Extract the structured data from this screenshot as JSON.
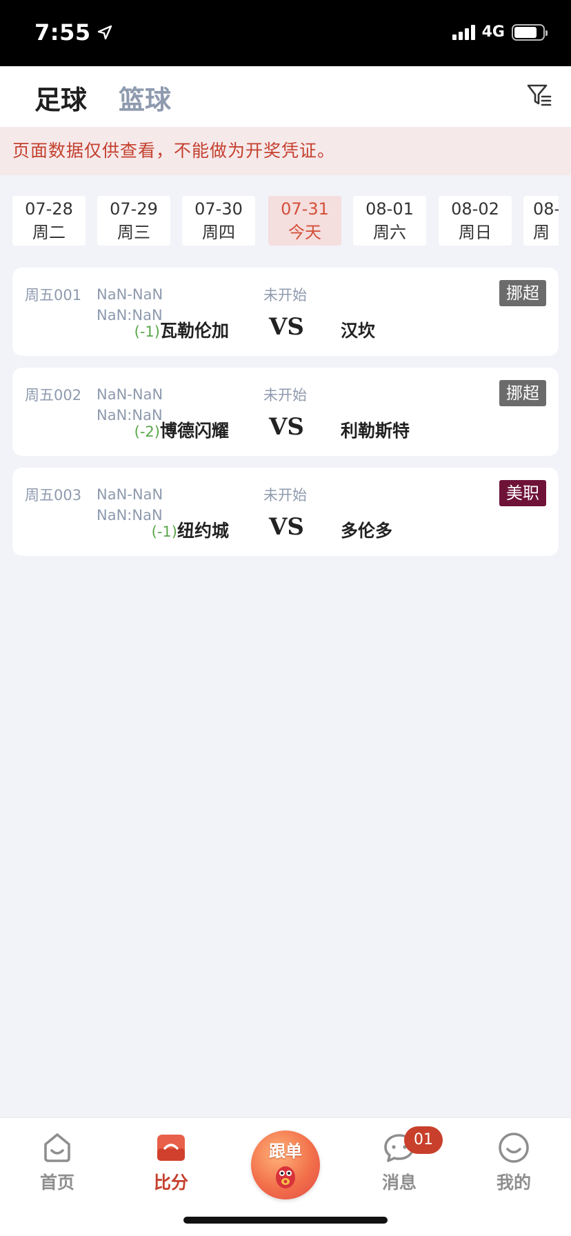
{
  "status_bar": {
    "time": "7:55",
    "network": "4G",
    "battery_level": 0.8
  },
  "header": {
    "tabs": [
      {
        "label": "足球",
        "active": true
      },
      {
        "label": "篮球",
        "active": false
      }
    ],
    "filter_icon": "filter-icon"
  },
  "notice": "页面数据仅供查看，不能做为开奖凭证。",
  "dates": [
    {
      "date": "07-28",
      "day": "周二",
      "active": false
    },
    {
      "date": "07-29",
      "day": "周三",
      "active": false
    },
    {
      "date": "07-30",
      "day": "周四",
      "active": false
    },
    {
      "date": "07-31",
      "day": "今天",
      "active": true
    },
    {
      "date": "08-01",
      "day": "周六",
      "active": false
    },
    {
      "date": "08-02",
      "day": "周日",
      "active": false
    },
    {
      "date": "08-",
      "day": "周",
      "active": false
    }
  ],
  "matches": [
    {
      "code": "周五001",
      "time_line1": "NaN-NaN",
      "time_line2": "NaN:NaN",
      "status": "未开始",
      "league": "挪超",
      "league_color": "#6b6b6b",
      "handicap": "(-1)",
      "home": "瓦勒伦加",
      "vs": "VS",
      "away": "汉坎"
    },
    {
      "code": "周五002",
      "time_line1": "NaN-NaN",
      "time_line2": "NaN:NaN",
      "status": "未开始",
      "league": "挪超",
      "league_color": "#6b6b6b",
      "handicap": "(-2)",
      "home": "博德闪耀",
      "vs": "VS",
      "away": "利勒斯特"
    },
    {
      "code": "周五003",
      "time_line1": "NaN-NaN",
      "time_line2": "NaN:NaN",
      "status": "未开始",
      "league": "美职",
      "league_color": "#6e1238",
      "handicap": "(-1)",
      "home": "纽约城",
      "vs": "VS",
      "away": "多伦多"
    }
  ],
  "bottom_nav": {
    "items": [
      {
        "label": "首页",
        "icon": "home-icon"
      },
      {
        "label": "比分",
        "icon": "score-icon",
        "active": true
      },
      {
        "label": "跟单",
        "icon": "follow-mascot-icon"
      },
      {
        "label": "消息",
        "icon": "message-icon",
        "badge": "01"
      },
      {
        "label": "我的",
        "icon": "profile-icon"
      }
    ]
  },
  "colors": {
    "accent": "#c4402e",
    "inactive_tab": "#8e9aae",
    "handicap_green": "#5aa64b",
    "background": "#f2f3f8"
  }
}
